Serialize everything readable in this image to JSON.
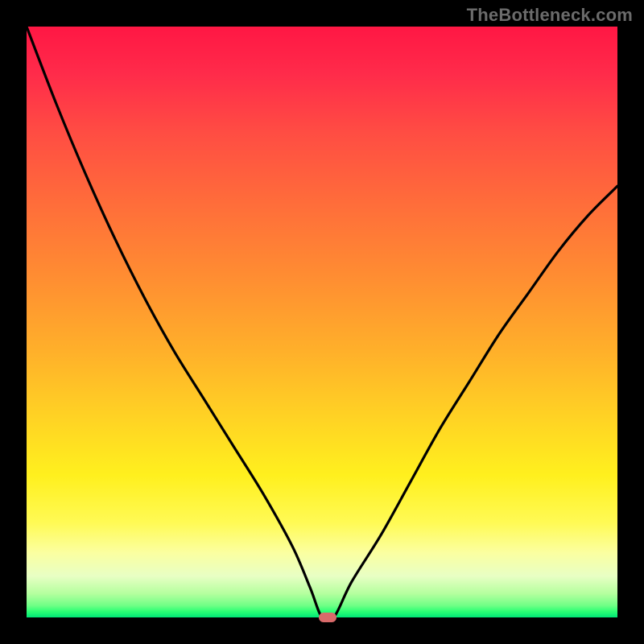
{
  "brand": {
    "watermark": "TheBottleneck.com"
  },
  "colors": {
    "frame": "#000000",
    "gradient_top": "#ff1744",
    "gradient_mid": "#ffd224",
    "gradient_bottom": "#00e676",
    "curve": "#000000",
    "marker": "#d96a6a",
    "watermark": "#6b6b6b"
  },
  "chart_data": {
    "type": "line",
    "title": "",
    "xlabel": "",
    "ylabel": "",
    "xlim": [
      0,
      100
    ],
    "ylim": [
      0,
      100
    ],
    "grid": false,
    "legend": false,
    "x": [
      0,
      5,
      10,
      15,
      20,
      25,
      30,
      35,
      40,
      45,
      48,
      50,
      52,
      55,
      60,
      65,
      70,
      75,
      80,
      85,
      90,
      95,
      100
    ],
    "values": [
      100,
      87,
      75,
      64,
      54,
      45,
      37,
      29,
      21,
      12,
      5,
      0,
      0,
      6,
      14,
      23,
      32,
      40,
      48,
      55,
      62,
      68,
      73
    ],
    "marker": {
      "x": 51,
      "y": 0
    },
    "annotations": []
  }
}
